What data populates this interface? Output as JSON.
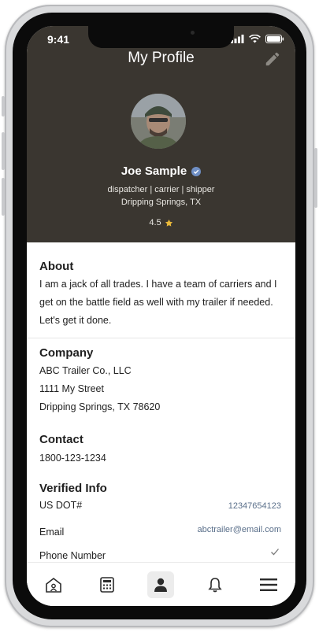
{
  "status_bar": {
    "time": "9:41"
  },
  "header": {
    "title": "My Profile",
    "name": "Joe Sample",
    "roles": "dispatcher | carrier | shipper",
    "location": "Dripping Springs, TX",
    "rating": "4.5"
  },
  "about": {
    "title": "About",
    "lines": [
      "I am a jack of all trades. I have a team of carriers and I",
      "get on the battle field as well with my trailer if needed.",
      "Let's get it done."
    ]
  },
  "company": {
    "title": "Company",
    "lines": [
      "ABC Trailer Co., LLC",
      "1111 My Street",
      "Dripping Springs, TX 78620"
    ]
  },
  "contact": {
    "title": "Contact",
    "phone": "1800-123-1234"
  },
  "verified": {
    "title": "Verified Info",
    "dot_label": "US DOT#",
    "dot_value": "12347654123",
    "email_label": "Email",
    "email_value": "abctrailer@email.com",
    "phone_label": "Phone Number"
  },
  "nav": {
    "items": [
      "home-icon",
      "calculator-icon",
      "profile-icon",
      "bell-icon",
      "menu-icon"
    ],
    "active": "profile-icon"
  },
  "colors": {
    "header_bg": "#3a3630",
    "star": "#e9b93a",
    "verified_badge": "#6f8fc4",
    "link": "#5a6f8a"
  }
}
